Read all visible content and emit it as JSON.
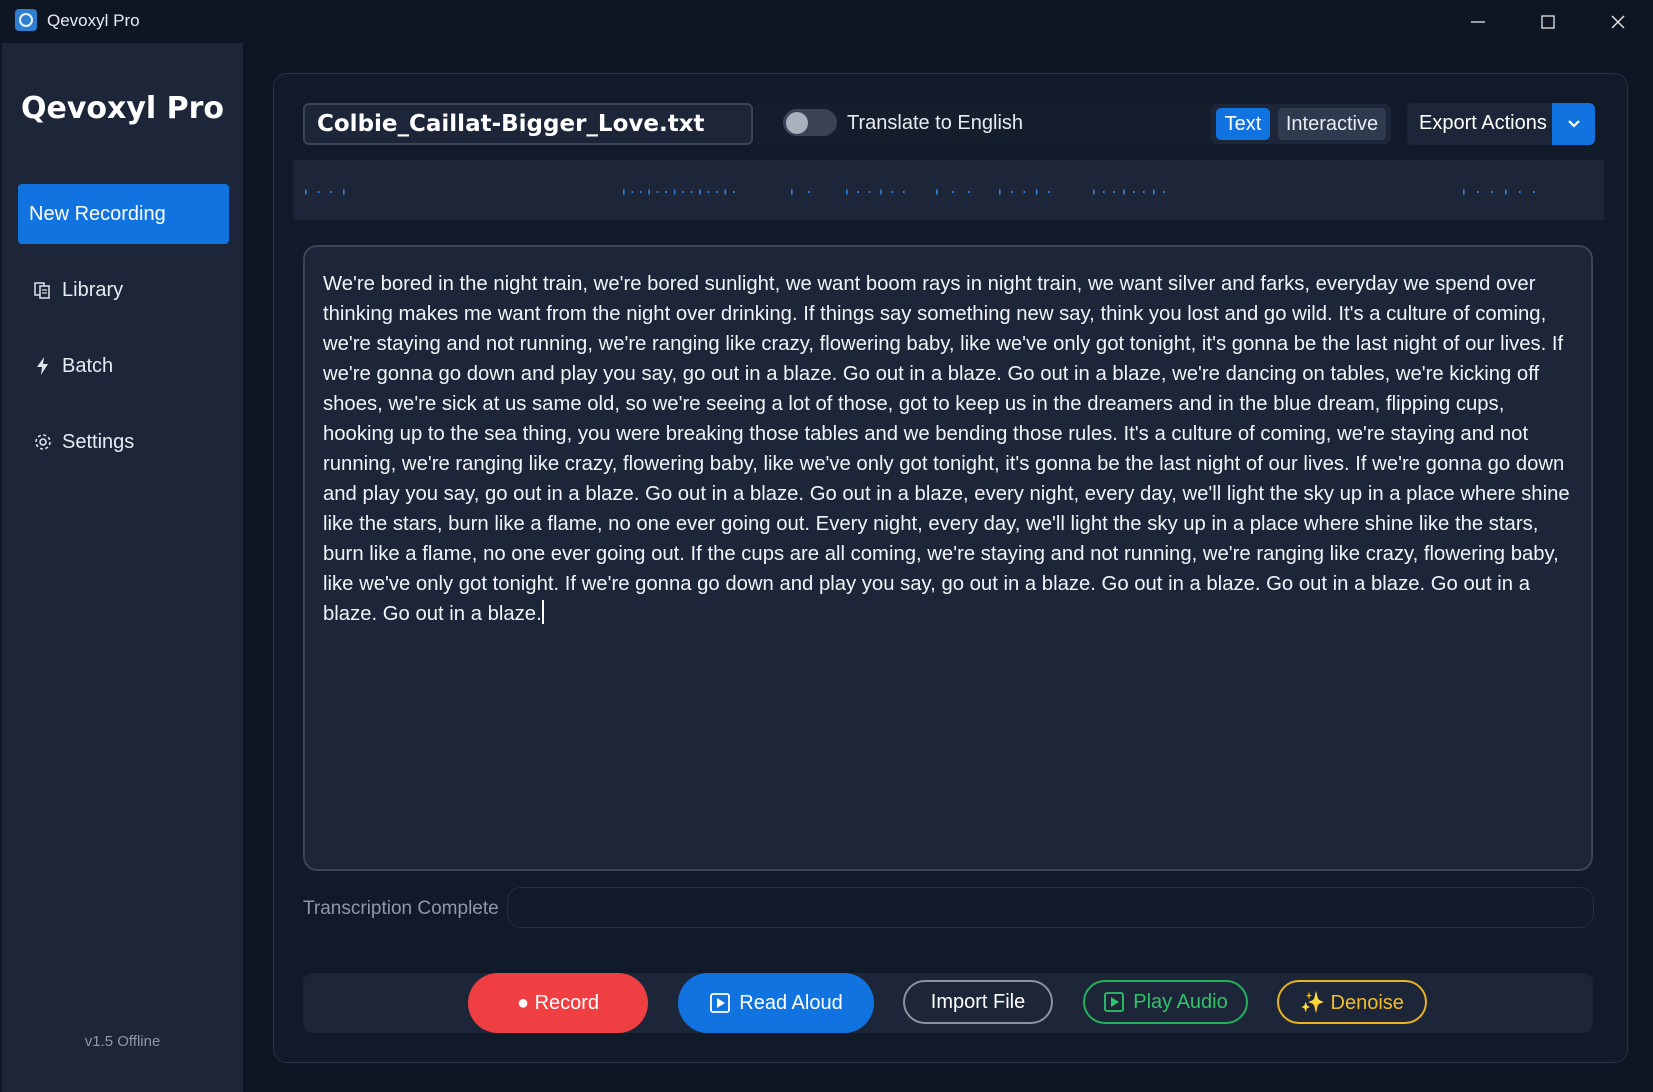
{
  "window": {
    "title": "Qevoxyl Pro",
    "icons": {
      "app": "app-icon",
      "minimize": "minimize-icon",
      "maximize": "maximize-icon",
      "close": "close-icon"
    }
  },
  "sidebar": {
    "brand": "Qevoxyl Pro",
    "items": [
      {
        "label": "New Recording",
        "icon": "",
        "active": true
      },
      {
        "label": "Library",
        "icon": "library-icon",
        "active": false
      },
      {
        "label": "Batch",
        "icon": "lightning-icon",
        "active": false
      },
      {
        "label": "Settings",
        "icon": "gear-icon",
        "active": false
      }
    ],
    "version": "v1.5 Offline"
  },
  "header": {
    "filename": "Colbie_Caillat-Bigger_Love.txt",
    "translate": {
      "label": "Translate to English",
      "enabled": false
    },
    "view_modes": [
      {
        "label": "Text",
        "selected": true
      },
      {
        "label": "Interactive",
        "selected": false
      }
    ],
    "export": {
      "label": "Export Actions",
      "icon": "chevron-down-icon"
    }
  },
  "transcript": {
    "text": " We're bored in the night train, we're bored sunlight, we want boom rays in night train, we want silver and farks, everyday we spend over thinking makes me want from the night over drinking. If things say something new say, think you lost and go wild. It's a culture of coming, we're staying and not running, we're ranging like crazy, flowering baby, like we've only got tonight, it's gonna be the last night of our lives. If we're gonna go down and play you say, go out in a blaze. Go out in a blaze. Go out in a blaze, we're dancing on tables, we're kicking off shoes, we're sick at us same old, so we're seeing a lot of those, got to keep us in the dreamers and in the blue dream, flipping cups, hooking up to the sea thing, you were breaking those tables and we bending those rules. It's a culture of coming, we're staying and not running, we're ranging like crazy, flowering baby, like we've only got tonight, it's gonna be the last night of our lives. If we're gonna go down and play you say, go out in a blaze. Go out in a blaze. Go out in a blaze, every night, every day, we'll light the sky up in a place where shine like the stars, burn like a flame, no one ever going out. Every night, every day, we'll light the sky up in a place where shine like the stars, burn like a flame, no one ever going out. If the cups are all coming, we're staying and not running, we're ranging like crazy, flowering baby, like we've only got tonight. If we're gonna go down and play you say, go out in a blaze. Go out in a blaze. Go out in a blaze. Go out in a blaze. Go out in a blaze."
  },
  "status": {
    "label": "Transcription Complete",
    "progress": 0
  },
  "actions": {
    "record": {
      "label": "● Record"
    },
    "read_aloud": {
      "label": "Read Aloud",
      "icon": "play-square-icon"
    },
    "import_file": {
      "label": "Import File"
    },
    "play_audio": {
      "label": "Play Audio",
      "icon": "play-square-icon"
    },
    "denoise": {
      "label": "✨ Denoise"
    }
  },
  "colors": {
    "accent": "#1173e0",
    "record": "#ef3f43",
    "play": "#24b15c",
    "denoise": "#e9b321",
    "background": "#0f1623",
    "panel": "#1c2638"
  }
}
